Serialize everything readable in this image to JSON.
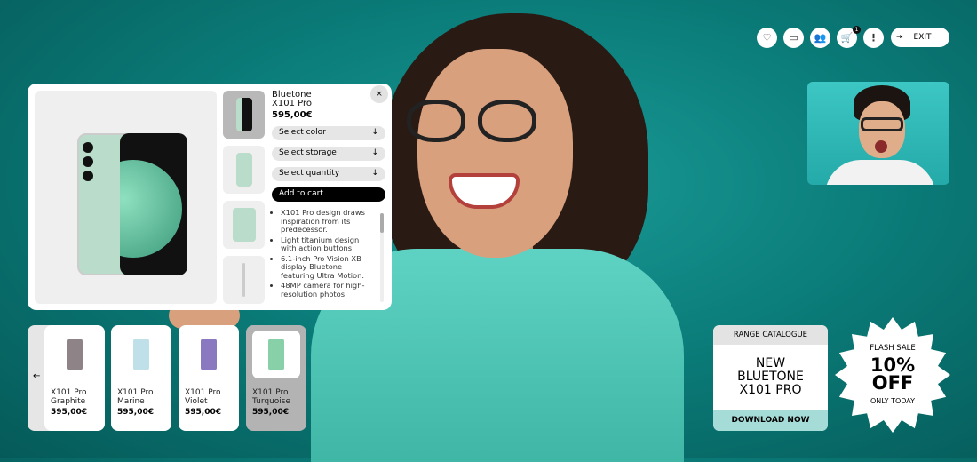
{
  "header": {
    "icons": [
      "heart-icon",
      "chat-icon",
      "users-icon",
      "cart-icon",
      "more-icon"
    ],
    "cart_count": "1",
    "exit_label": "EXIT"
  },
  "product": {
    "brand": "Bluetone",
    "model": "X101 Pro",
    "price": "595,00€",
    "select_color": "Select color",
    "select_storage": "Select storage",
    "select_quantity": "Select quantity",
    "add_to_cart": "Add to cart",
    "close": "×",
    "features": [
      "X101 Pro design draws inspiration from its predecessor.",
      "Light titanium design with action buttons.",
      "6.1-inch Pro Vision XB display Bluetone featuring Ultra Motion.",
      "48MP camera for high-resolution photos."
    ]
  },
  "carousel": {
    "back": "←",
    "items": [
      {
        "name": "X101 Pro",
        "variant": "Graphite",
        "price": "595,00€",
        "color": "#8e8488"
      },
      {
        "name": "X101 Pro",
        "variant": "Marine",
        "price": "595,00€",
        "color": "#bfe0e8"
      },
      {
        "name": "X101 Pro",
        "variant": "Violet",
        "price": "595,00€",
        "color": "#8a78c0"
      },
      {
        "name": "X101 Pro",
        "variant": "Turquoise",
        "price": "595,00€",
        "color": "#88d0a8"
      }
    ]
  },
  "catalogue": {
    "header": "RANGE CATALOGUE",
    "line1": "NEW",
    "line2": "BLUETONE",
    "line3": "X101 PRO",
    "cta": "DOWNLOAD NOW"
  },
  "sale": {
    "top": "FLASH SALE",
    "big1": "10%",
    "big2": "OFF",
    "bottom": "ONLY TODAY"
  }
}
